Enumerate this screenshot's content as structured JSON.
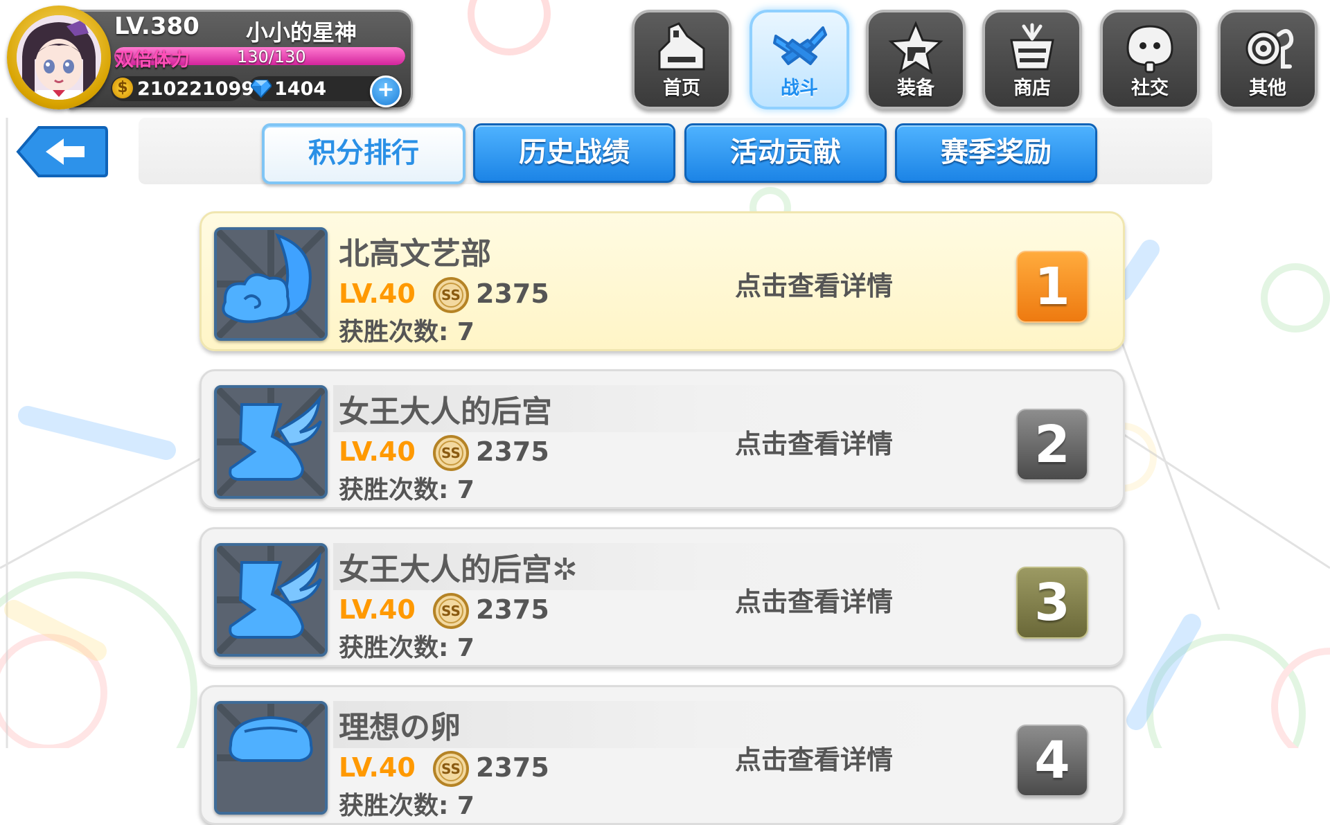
{
  "player": {
    "level": "LV.380",
    "name": "小小的星神",
    "stamina_label": "双倍体力",
    "stamina_value": "130/130",
    "stamina_fraction": 1.0,
    "gold": "210221099",
    "gems": "1404",
    "plus_icon": "+"
  },
  "nav": [
    {
      "label": "首页",
      "icon": "home-icon",
      "active": false
    },
    {
      "label": "战斗",
      "icon": "crossed-swords-icon",
      "active": true
    },
    {
      "label": "装备",
      "icon": "star-gun-icon",
      "active": false
    },
    {
      "label": "商店",
      "icon": "gift-basket-icon",
      "active": false
    },
    {
      "label": "社交",
      "icon": "cat-face-icon",
      "active": false
    },
    {
      "label": "其他",
      "icon": "settings-swirl-icon",
      "active": false
    }
  ],
  "tabs": [
    {
      "label": "积分排行",
      "active": true
    },
    {
      "label": "历史战绩",
      "active": false
    },
    {
      "label": "活动贡献",
      "active": false
    },
    {
      "label": "赛季奖励",
      "active": false
    }
  ],
  "ranking": [
    {
      "rank": "1",
      "name": "北高文艺部",
      "level": "LV.40",
      "score": "2375",
      "wins": "获胜次数: 7",
      "detail": "点击查看详情",
      "icon": "cloud-wing-icon",
      "badge_color": "#f08a1e"
    },
    {
      "rank": "2",
      "name": "女王大人的后宫",
      "level": "LV.40",
      "score": "2375",
      "wins": "获胜次数: 7",
      "detail": "点击查看详情",
      "icon": "winged-boot-icon",
      "badge_color": "#5a5a5a"
    },
    {
      "rank": "3",
      "name": "女王大人的后宫✲",
      "level": "LV.40",
      "score": "2375",
      "wins": "获胜次数: 7",
      "detail": "点击查看详情",
      "icon": "winged-boot-icon",
      "badge_color": "#7a7848"
    },
    {
      "rank": "4",
      "name": "理想の卵",
      "level": "LV.40",
      "score": "2375",
      "wins": "获胜次数: 7",
      "detail": "点击查看详情",
      "icon": "hat-icon",
      "badge_color": "#5a5a5a"
    }
  ],
  "colors": {
    "accent_blue": "#1c84e6",
    "level_orange": "#ff9900",
    "stamina_pink": "#ff4fb8"
  }
}
